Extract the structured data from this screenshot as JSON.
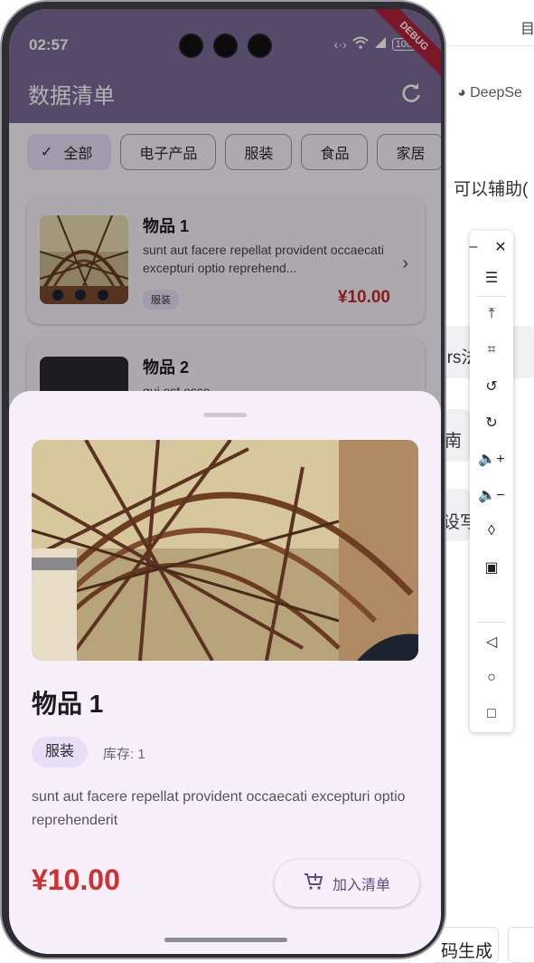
{
  "status_bar": {
    "time": "02:57",
    "battery": "100"
  },
  "debug_banner": "DEBUG",
  "app_bar": {
    "title": "数据清单",
    "refresh_icon": "refresh-icon"
  },
  "filters": [
    {
      "label": "全部",
      "selected": true
    },
    {
      "label": "电子产品",
      "selected": false
    },
    {
      "label": "服装",
      "selected": false
    },
    {
      "label": "食品",
      "selected": false
    },
    {
      "label": "家居",
      "selected": false
    }
  ],
  "list": [
    {
      "name": "物品 1",
      "description": "sunt aut facere repellat provident occaecati excepturi optio reprehend...",
      "tag": "服装",
      "price": "¥10.00"
    },
    {
      "name": "物品 2",
      "description": "qui est esse",
      "tag": "",
      "price": ""
    }
  ],
  "detail_sheet": {
    "name": "物品 1",
    "tag": "服装",
    "stock": "库存: 1",
    "description": "sunt aut facere repellat provident occaecati excepturi optio reprehenderit",
    "price": "¥10.00",
    "add_button": "加入清单"
  },
  "background_page": {
    "brand": "DeepSe",
    "line1": "可以辅助(",
    "chip1": "ers法 论",
    "chip2": "南",
    "chip3": "设写",
    "bottom_chip": "码生成",
    "top_right": "目"
  },
  "colors": {
    "app_bar": "#7b6a98",
    "accent_chip": "#e8def8",
    "price": "#d32f2f"
  }
}
